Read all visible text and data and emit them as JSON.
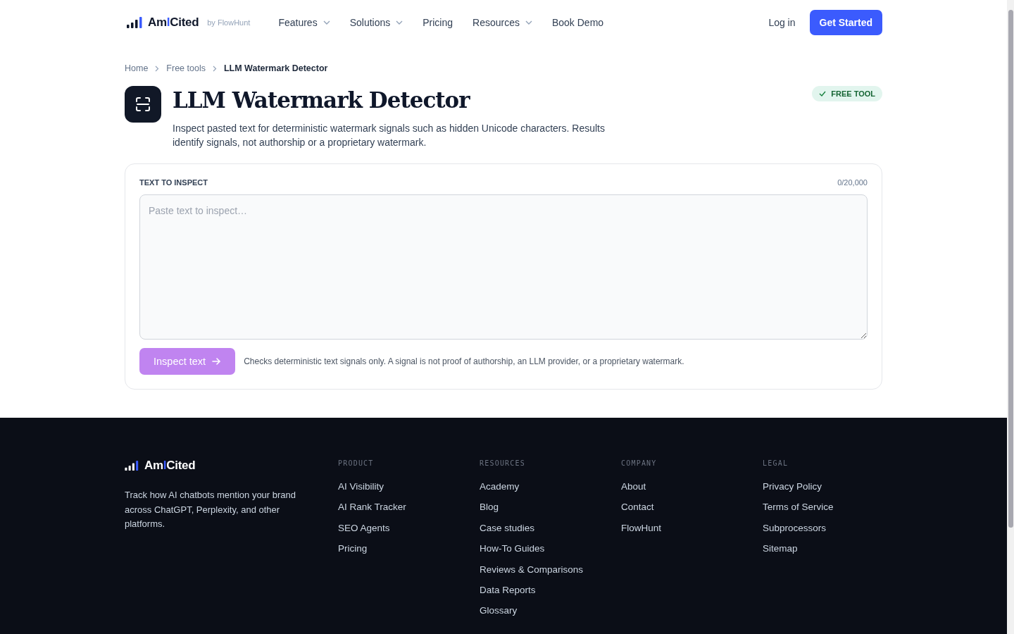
{
  "header": {
    "logo": {
      "parts": [
        "Am",
        "I",
        "Cited"
      ],
      "byline": "by FlowHunt"
    },
    "nav": [
      {
        "label": "Features",
        "dropdown": true
      },
      {
        "label": "Solutions",
        "dropdown": true
      },
      {
        "label": "Pricing",
        "dropdown": false
      },
      {
        "label": "Resources",
        "dropdown": true
      },
      {
        "label": "Book Demo",
        "dropdown": false
      }
    ],
    "login": "Log in",
    "cta": "Get Started"
  },
  "breadcrumb": [
    {
      "label": "Home",
      "current": false
    },
    {
      "label": "Free tools",
      "current": false
    },
    {
      "label": "LLM Watermark Detector",
      "current": true
    }
  ],
  "tool": {
    "title": "LLM Watermark Detector",
    "badge": "FREE TOOL",
    "description": "Inspect pasted text for deterministic watermark signals such as hidden Unicode characters. Results identify signals, not authorship or a proprietary watermark."
  },
  "form": {
    "label": "TEXT TO INSPECT",
    "counter": "0/20,000",
    "placeholder": "Paste text to inspect…",
    "button": {
      "label": "Inspect text",
      "disabled": true
    },
    "note": "Checks deterministic text signals only. A signal is not proof of authorship, an LLM provider, or a proprietary watermark."
  },
  "footer": {
    "logo": {
      "parts": [
        "Am",
        "I",
        "Cited"
      ]
    },
    "tagline": "Track how AI chatbots mention your brand across ChatGPT, Perplexity, and other platforms.",
    "columns": [
      {
        "heading": "PRODUCT",
        "links": [
          "AI Visibility",
          "AI Rank Tracker",
          "SEO Agents",
          "Pricing"
        ]
      },
      {
        "heading": "RESOURCES",
        "links": [
          "Academy",
          "Blog",
          "Case studies",
          "How-To Guides",
          "Reviews & Comparisons",
          "Data Reports",
          "Glossary"
        ]
      },
      {
        "heading": "COMPANY",
        "links": [
          "About",
          "Contact",
          "FlowHunt"
        ]
      },
      {
        "heading": "LEGAL",
        "links": [
          "Privacy Policy",
          "Terms of Service",
          "Subprocessors",
          "Sitemap"
        ]
      }
    ]
  }
}
